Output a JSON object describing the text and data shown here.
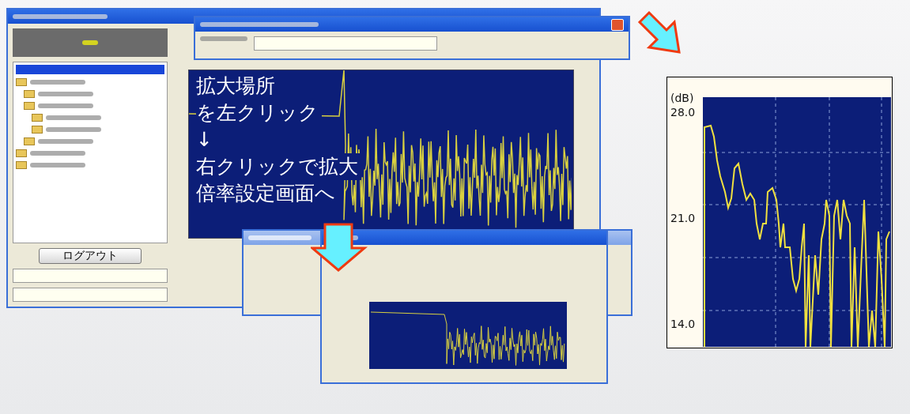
{
  "main_window": {
    "logout_button": "ログアウト"
  },
  "annotation": {
    "lines": [
      "拡大場所",
      "を左クリック",
      "↓",
      "右クリックで拡大",
      "倍率設定画面へ"
    ]
  },
  "zoom_chart": {
    "unit": "(dB)",
    "y_labels": [
      "28.0",
      "21.0",
      "14.0"
    ]
  }
}
